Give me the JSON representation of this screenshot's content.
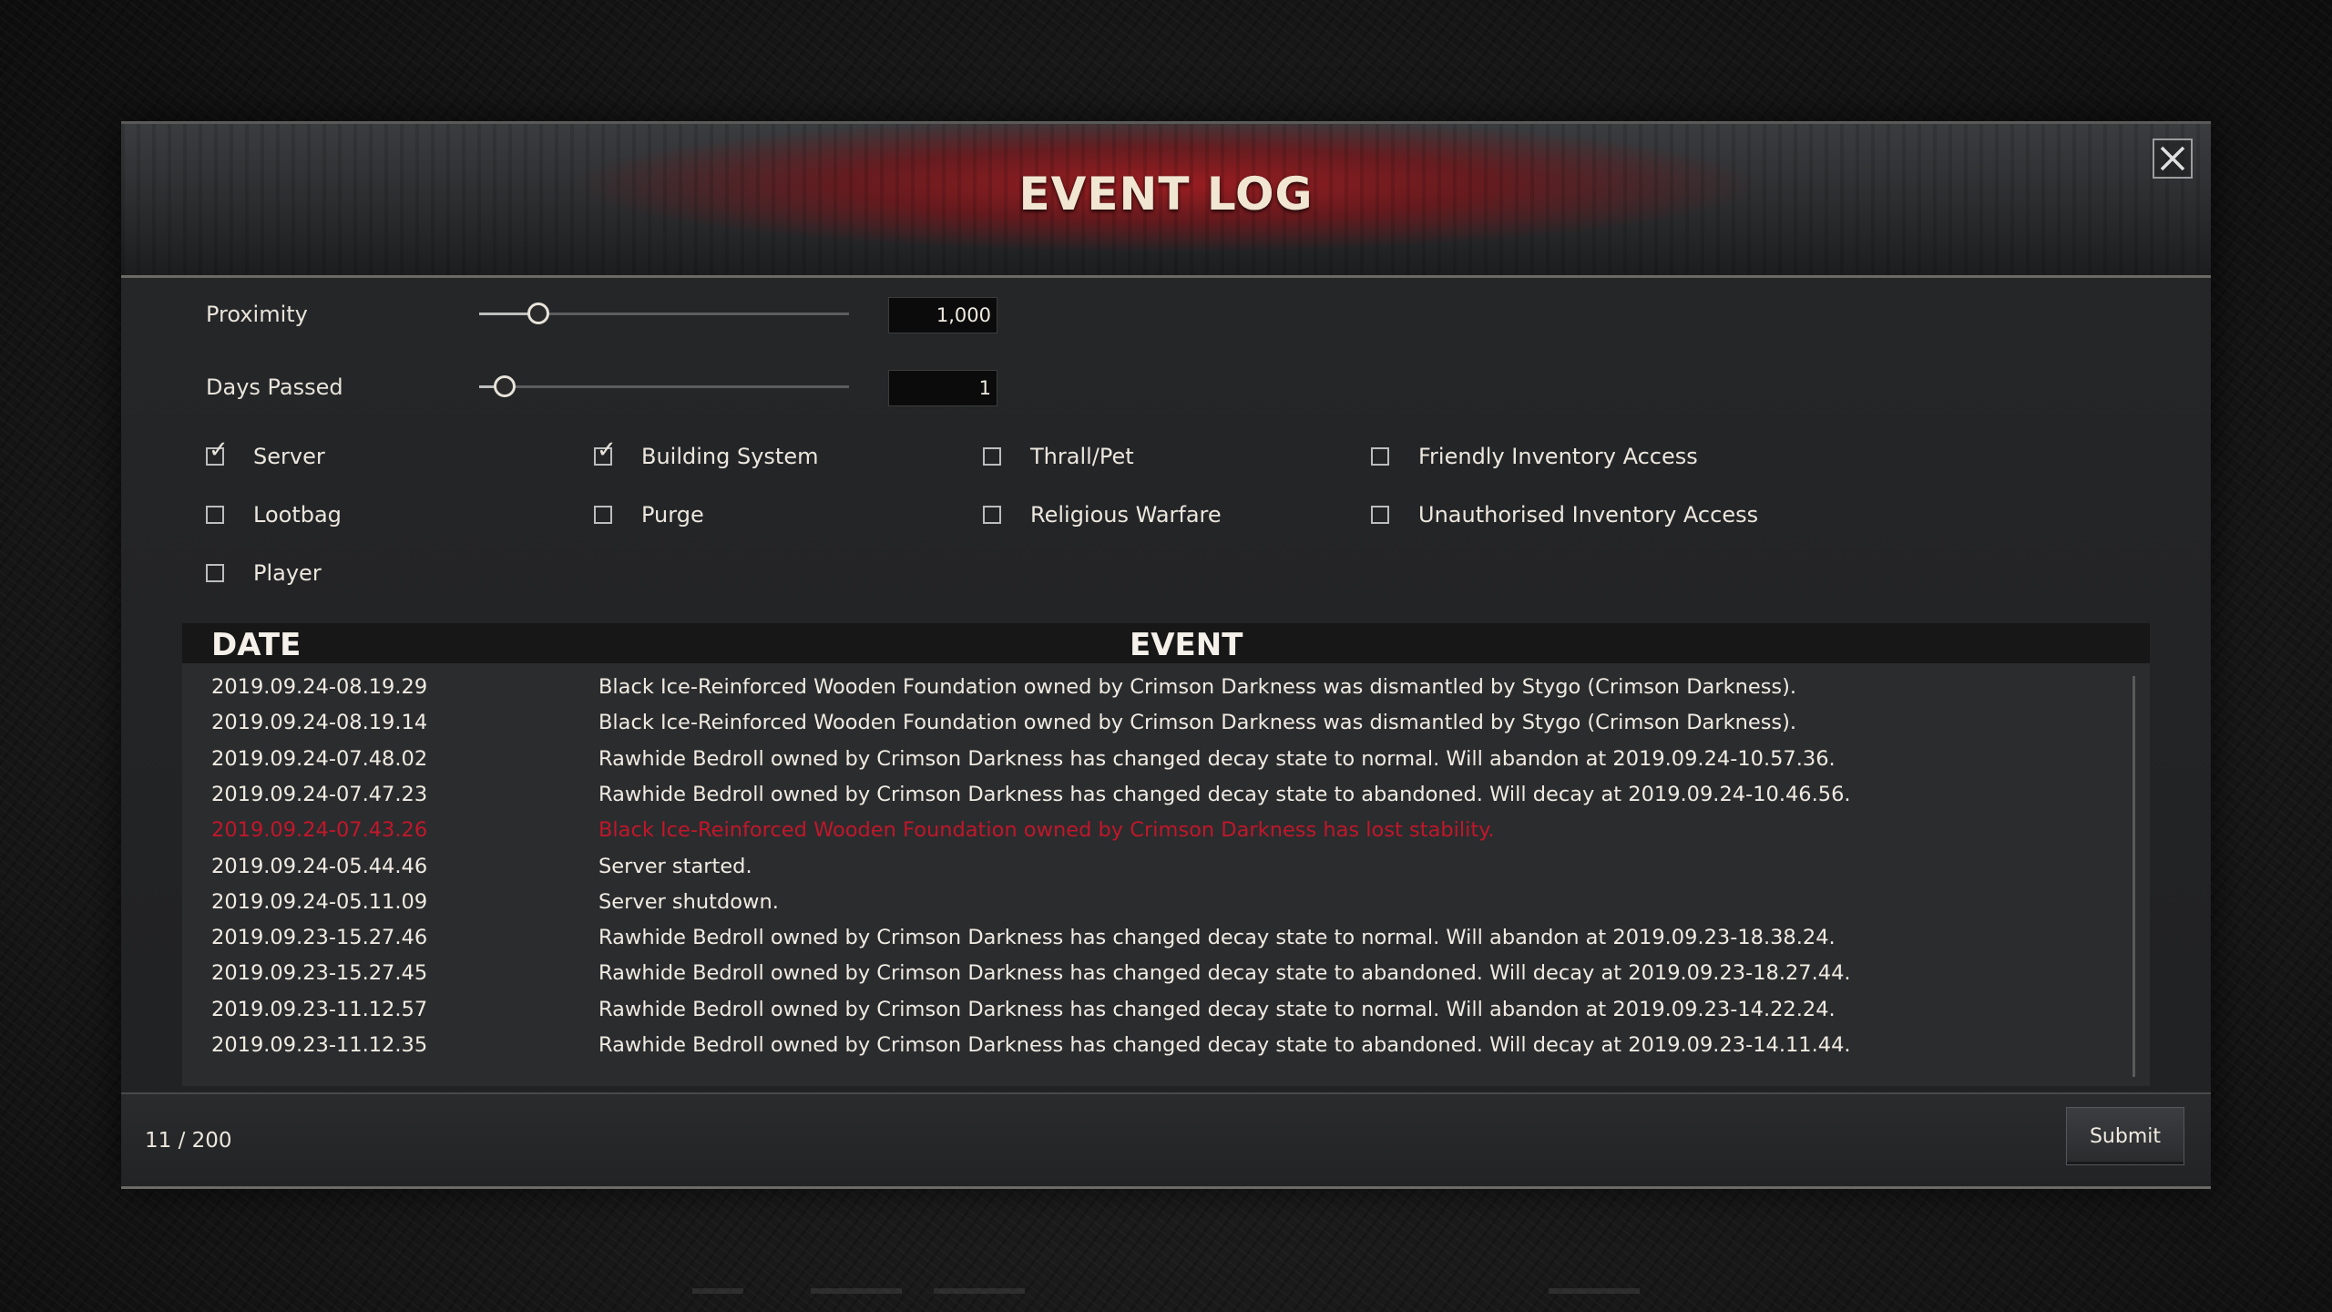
{
  "dialog": {
    "title": "EVENT LOG",
    "close_icon": "close-icon"
  },
  "filters": {
    "proximity": {
      "label": "Proximity",
      "value": "1,000",
      "level": 0.16
    },
    "days_passed": {
      "label": "Days Passed",
      "value": "1",
      "level": 0.07
    }
  },
  "categories": [
    {
      "label": "Server",
      "checked": true
    },
    {
      "label": "Building System",
      "checked": true
    },
    {
      "label": "Thrall/Pet",
      "checked": false
    },
    {
      "label": "Friendly Inventory Access",
      "checked": false
    },
    {
      "label": "Lootbag",
      "checked": false
    },
    {
      "label": "Purge",
      "checked": false
    },
    {
      "label": "Religious Warfare",
      "checked": false
    },
    {
      "label": "Unauthorised Inventory Access",
      "checked": false
    },
    {
      "label": "Player",
      "checked": false
    }
  ],
  "log": {
    "columns": {
      "date": "DATE",
      "event": "EVENT"
    },
    "rows": [
      {
        "date": "2019.09.24-08.19.29",
        "event": "Black Ice-Reinforced Wooden Foundation owned by Crimson Darkness was dismantled by Stygo (Crimson Darkness).",
        "alert": false
      },
      {
        "date": "2019.09.24-08.19.14",
        "event": "Black Ice-Reinforced Wooden Foundation owned by Crimson Darkness was dismantled by Stygo (Crimson Darkness).",
        "alert": false
      },
      {
        "date": "2019.09.24-07.48.02",
        "event": "Rawhide Bedroll owned by Crimson Darkness has changed decay state to normal. Will abandon at 2019.09.24-10.57.36.",
        "alert": false
      },
      {
        "date": "2019.09.24-07.47.23",
        "event": "Rawhide Bedroll owned by Crimson Darkness has changed decay state to abandoned. Will decay at 2019.09.24-10.46.56.",
        "alert": false
      },
      {
        "date": "2019.09.24-07.43.26",
        "event": "Black Ice-Reinforced Wooden Foundation owned by Crimson Darkness has lost stability.",
        "alert": true
      },
      {
        "date": "2019.09.24-05.44.46",
        "event": "Server started.",
        "alert": false
      },
      {
        "date": "2019.09.24-05.11.09",
        "event": "Server shutdown.",
        "alert": false
      },
      {
        "date": "2019.09.23-15.27.46",
        "event": "Rawhide Bedroll owned by Crimson Darkness has changed decay state to normal. Will abandon at 2019.09.23-18.38.24.",
        "alert": false
      },
      {
        "date": "2019.09.23-15.27.45",
        "event": "Rawhide Bedroll owned by Crimson Darkness has changed decay state to abandoned. Will decay at 2019.09.23-18.27.44.",
        "alert": false
      },
      {
        "date": "2019.09.23-11.12.57",
        "event": "Rawhide Bedroll owned by Crimson Darkness has changed decay state to normal. Will abandon at 2019.09.23-14.22.24.",
        "alert": false
      },
      {
        "date": "2019.09.23-11.12.35",
        "event": "Rawhide Bedroll owned by Crimson Darkness has changed decay state to abandoned. Will decay at 2019.09.23-14.11.44.",
        "alert": false
      }
    ]
  },
  "footer": {
    "count": "11 / 200",
    "submit_label": "Submit"
  },
  "colors": {
    "accent_red": "#a01c20",
    "alert_text": "#c1172a",
    "text": "#e8e3da"
  }
}
